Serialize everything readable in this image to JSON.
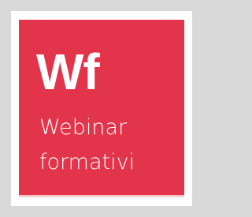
{
  "logo": {
    "monogram": "Wf",
    "title_line_1": "Webinar",
    "title_line_2": "formativi"
  },
  "colors": {
    "background": "#d9d9d9",
    "frame": "#ffffff",
    "tile": "#e2344a",
    "text": "#ffffff"
  }
}
